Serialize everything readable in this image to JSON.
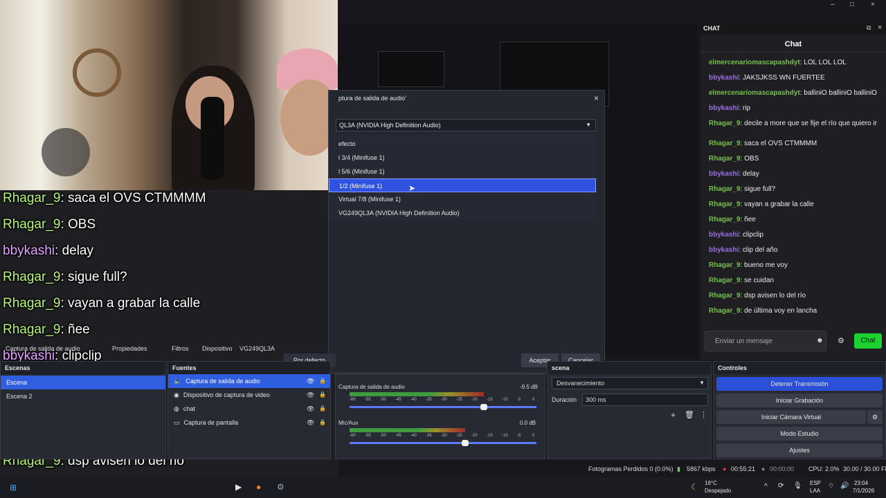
{
  "chat_overlay": {
    "lines": [
      {
        "user": "Rhagar_9",
        "text": "saca el OVS CTMMMM",
        "color": "green"
      },
      {
        "user": "Rhagar_9",
        "text": "OBS",
        "color": "green"
      },
      {
        "user": "bbykashi",
        "text": "delay",
        "color": "purple"
      },
      {
        "user": "Rhagar_9",
        "text": "sigue full?",
        "color": "green"
      },
      {
        "user": "Rhagar_9",
        "text": "vayan a grabar la calle",
        "color": "green"
      },
      {
        "user": "Rhagar_9",
        "text": "ñee",
        "color": "green"
      },
      {
        "user": "bbykashi",
        "text": "clipclip",
        "color": "purple"
      },
      {
        "user": "bbykashi",
        "text": "clip del año",
        "color": "purple"
      },
      {
        "user": "Rhagar_9",
        "text": "bueno me voy",
        "color": "green"
      },
      {
        "user": "Rhagar_9",
        "text": "se cuidan",
        "color": "green"
      },
      {
        "user": "Rhagar_9",
        "text": "dsp avisen lo del rio",
        "color": "green"
      },
      {
        "user": "Rhagar_9",
        "text": "de última voy en lancha",
        "color": "green"
      }
    ]
  },
  "chat_dock": {
    "window_label": "CHAT",
    "title": "Chat",
    "messages": [
      {
        "user": "elmercenariomascapashdyt",
        "text": "LOL LOL LOL",
        "kind": "green"
      },
      {
        "user": "bbykashi",
        "text": "JAKSJKSS WN FUERTEE",
        "kind": "purple"
      },
      {
        "user": "elmercenariomascapashdyt",
        "text": "balliniO balliniO balliniO",
        "kind": "green"
      },
      {
        "user": "bbykashi",
        "text": "rip",
        "kind": "purple"
      },
      {
        "user": "Rhagar_9",
        "text": "decile a more que se fije el río que quiero ir",
        "kind": "green"
      },
      {
        "user": "Rhagar_9",
        "text": "saca el OVS CTMMMM",
        "kind": "green"
      },
      {
        "user": "Rhagar_9",
        "text": "OBS",
        "kind": "green"
      },
      {
        "user": "bbykashi",
        "text": "delay",
        "kind": "purple"
      },
      {
        "user": "Rhagar_9",
        "text": "sigue full?",
        "kind": "green"
      },
      {
        "user": "Rhagar_9",
        "text": "vayan a grabar la calle",
        "kind": "green"
      },
      {
        "user": "Rhagar_9",
        "text": "ñee",
        "kind": "green"
      },
      {
        "user": "bbykashi",
        "text": "clipclip",
        "kind": "purple"
      },
      {
        "user": "bbykashi",
        "text": "clip del año",
        "kind": "purple"
      },
      {
        "user": "Rhagar_9",
        "text": "bueno me voy",
        "kind": "green"
      },
      {
        "user": "Rhagar_9",
        "text": "se cuidan",
        "kind": "green"
      },
      {
        "user": "Rhagar_9",
        "text": "dsp avisen lo del río",
        "kind": "green"
      },
      {
        "user": "Rhagar_9",
        "text": "de última voy en lancha",
        "kind": "green"
      }
    ],
    "input_placeholder": "Enviar un mensaje",
    "send_label": "Chat"
  },
  "dialog": {
    "title": "ptura de salida de audio'",
    "selected_device": "QL3A (NVIDIA High Definition Audio)",
    "options": [
      "efecto",
      "l 3/4 (Minifuse 1)",
      "l 5/6 (Minifuse 1)",
      "1/2 (Minifuse 1)",
      "Virtual 7/8 (Minifuse 1)",
      "VG249QL3A (NVIDIA High Definition Audio)"
    ],
    "selected_index": 3,
    "default_button": "Por defecto",
    "accept_button": "Aceptar",
    "cancel_button": "Cancelar"
  },
  "toolbar": {
    "source_label": "Captura de salida de audio",
    "properties_label": "Propiedades",
    "filters_label": "Filtros",
    "device_label": "Dispositivo",
    "device_value": "VG249QL3A"
  },
  "scenes": {
    "title": "Escenas",
    "items": [
      "Escena",
      "Escena 2"
    ]
  },
  "sources": {
    "title": "Fuentes",
    "items": [
      {
        "label": "Captura de salida de audio",
        "icon": "speaker-icon"
      },
      {
        "label": "Dispositivo de captura de video",
        "icon": "camera-icon"
      },
      {
        "label": "chat",
        "icon": "globe-icon"
      },
      {
        "label": "Captura de pantalla",
        "icon": "monitor-icon"
      }
    ]
  },
  "mixer": {
    "tracks": [
      {
        "name": "Captura de salida de audio",
        "db": "-9.5 dB",
        "level": 0.72
      },
      {
        "name": "Mic/Aux",
        "db": "0.0 dB",
        "level": 0.62
      }
    ],
    "scale": [
      "-60",
      "-55",
      "-50",
      "-45",
      "-40",
      "-35",
      "-30",
      "-25",
      "-20",
      "-15",
      "-10",
      "-5",
      "0"
    ]
  },
  "transitions": {
    "title": "scena",
    "type_value": "Desvanecimiento",
    "duration_label": "Duración",
    "duration_value": "300 ms"
  },
  "controls": {
    "title": "Controles",
    "buttons": [
      "Detener Transmisión",
      "Iniciar Grabación",
      "Iniciar Cámara Virtual",
      "Modo Estudio",
      "Ajustes"
    ]
  },
  "statusbar": {
    "dropped": "Fotogramas Perdidos 0 (0.0%)",
    "bitrate": "5867 kbps",
    "live_time": "00:55:21",
    "rec_time": "00:00:00",
    "cpu": "CPU: 2.0%",
    "fps": "30.00 / 30.00 FPS"
  },
  "taskbar": {
    "weather_temp": "16°C",
    "weather_desc": "Despejado",
    "lang_top": "ESP",
    "lang_bottom": "LAA",
    "time": "23:04",
    "date": "7/1/2026"
  }
}
